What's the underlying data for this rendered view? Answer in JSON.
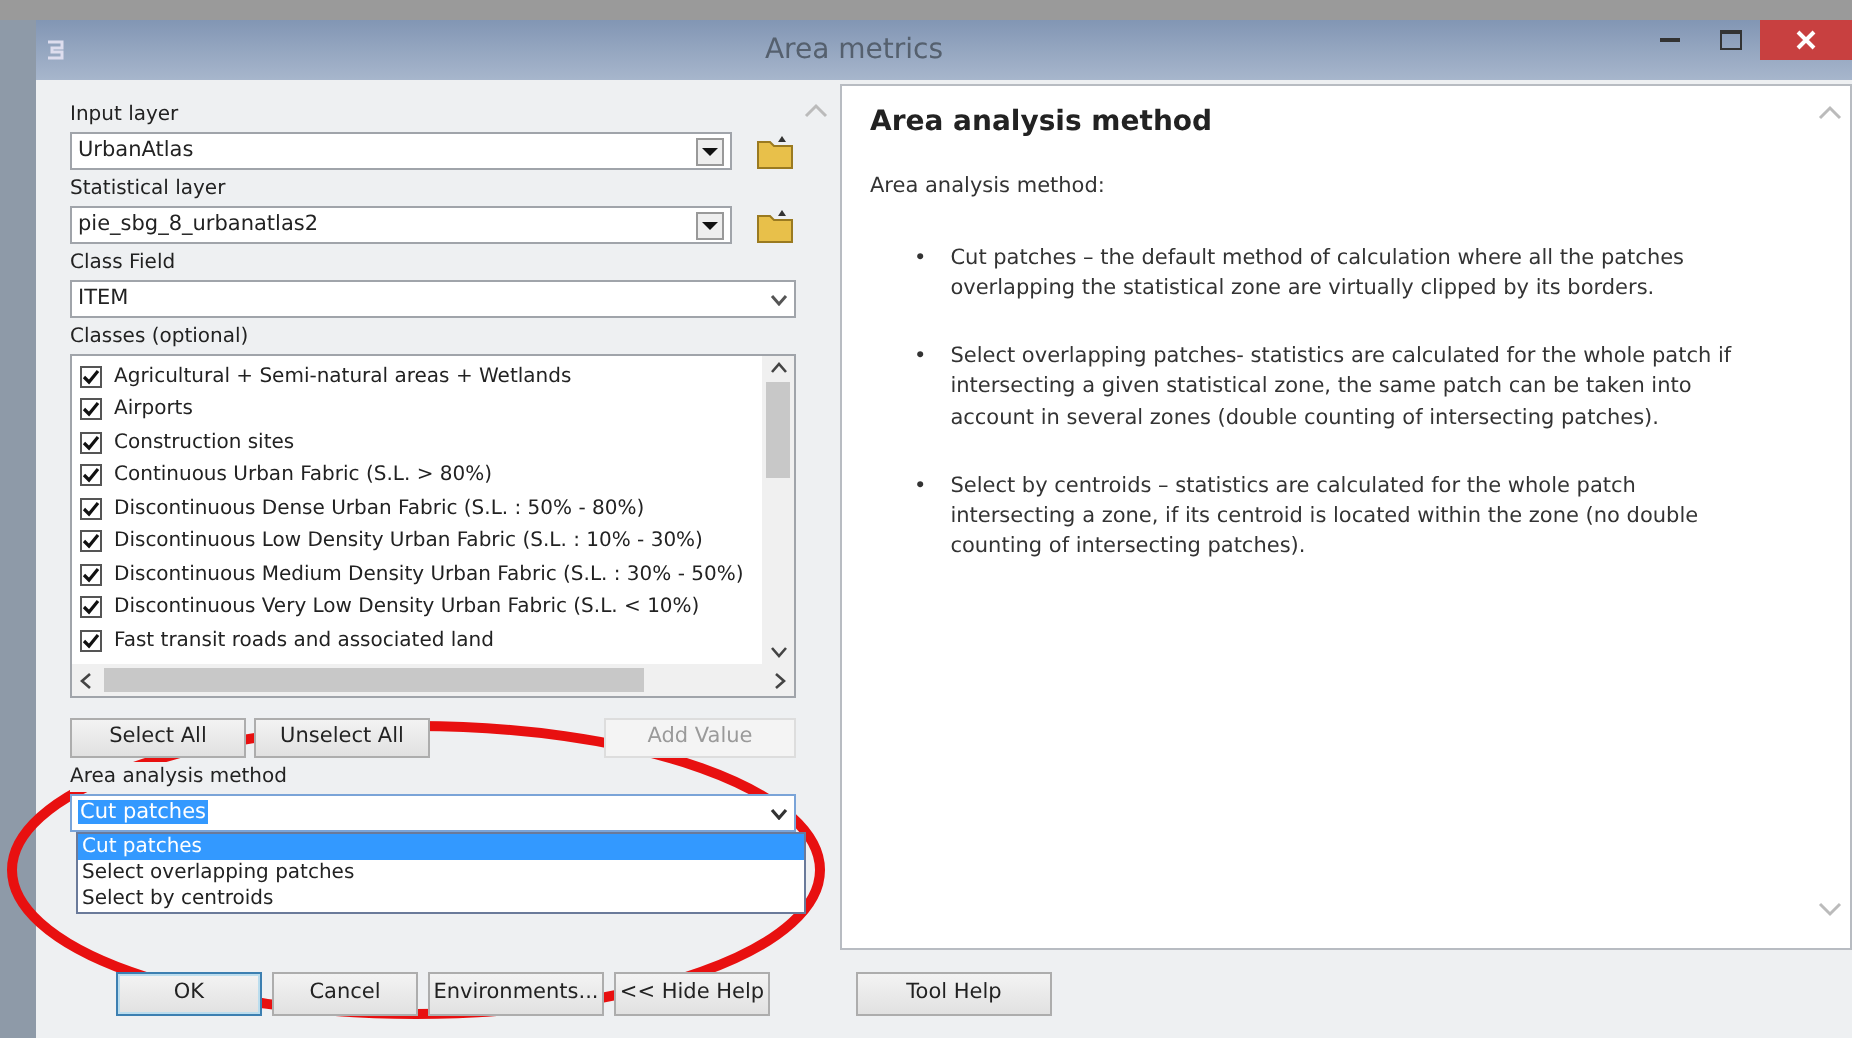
{
  "window": {
    "title": "Area metrics"
  },
  "form": {
    "fields": [
      {
        "kind": "combo-browse",
        "label": "Input layer",
        "value": "UrbanAtlas"
      },
      {
        "kind": "combo-browse",
        "label": "Statistical layer",
        "value": "pie_sbg_8_urbanatlas2"
      },
      {
        "kind": "select",
        "label": "Class Field",
        "value": "ITEM"
      }
    ],
    "classes": {
      "label": "Classes (optional)",
      "items": [
        {
          "label": "Agricultural + Semi-natural areas + Wetlands",
          "checked": true
        },
        {
          "label": "Airports",
          "checked": true
        },
        {
          "label": "Construction sites",
          "checked": true
        },
        {
          "label": "Continuous Urban Fabric (S.L. > 80%)",
          "checked": true
        },
        {
          "label": "Discontinuous Dense Urban Fabric (S.L. : 50% -  80%)",
          "checked": true
        },
        {
          "label": "Discontinuous Low Density Urban Fabric (S.L. : 10% - 30%)",
          "checked": true
        },
        {
          "label": "Discontinuous Medium Density Urban Fabric (S.L. : 30% - 50%)",
          "checked": true
        },
        {
          "label": "Discontinuous Very Low Density Urban Fabric (S.L. < 10%)",
          "checked": true
        },
        {
          "label": "Fast transit roads and associated land",
          "checked": true
        }
      ]
    },
    "buttons": [
      {
        "label": "Select All",
        "disabled": false
      },
      {
        "label": "Unselect All",
        "disabled": false
      },
      {
        "label": "Add Value",
        "disabled": true
      }
    ],
    "method": {
      "label": "Area analysis method",
      "value": "Cut patches",
      "options": [
        {
          "label": "Cut patches",
          "selected": true
        },
        {
          "label": "Select overlapping patches",
          "selected": false
        },
        {
          "label": "Select by centroids",
          "selected": false
        }
      ]
    }
  },
  "help": {
    "title": "Area analysis method",
    "intro": "Area analysis method:",
    "bullets": [
      {
        "marker": "•",
        "text": "Cut patches – the default method of calculation where all the patches overlapping the statistical zone are virtually clipped by its borders."
      },
      {
        "marker": "•",
        "text": "Select overlapping patches- statistics are calculated for the whole patch if intersecting a given statistical zone, the same patch can be taken into account in several zones (double counting of intersecting patches)."
      },
      {
        "marker": "•",
        "text": "Select by centroids – statistics are calculated for the whole patch intersecting a zone, if its centroid is located within the zone (no double counting of intersecting patches)."
      }
    ]
  },
  "footer_buttons": [
    {
      "label": "OK",
      "default": true
    },
    {
      "label": "Cancel",
      "default": false
    },
    {
      "label": "Environments...",
      "default": false
    },
    {
      "label": "<< Hide Help",
      "default": false
    },
    {
      "label": "Tool Help",
      "default": false
    }
  ],
  "annotation": {
    "kind": "ellipse"
  }
}
